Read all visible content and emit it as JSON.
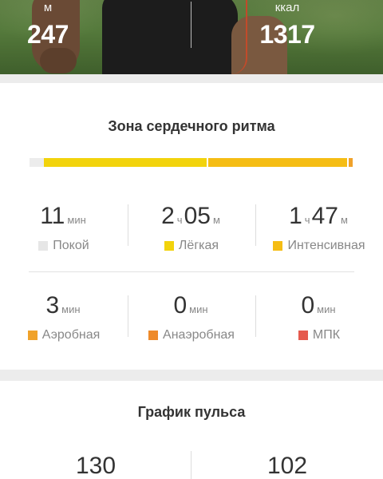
{
  "hero": {
    "left": {
      "unit": "м",
      "value": "247"
    },
    "right": {
      "unit": "ккал",
      "value": "1317"
    }
  },
  "heart_zone": {
    "title": "Зона сердечного ритма",
    "bar_fractions": {
      "rest": 0.045,
      "light": 0.51,
      "intensive": 0.44,
      "aerobic": 0.012
    },
    "zones": [
      {
        "value_parts": [
          {
            "n": "11",
            "u": "мин"
          }
        ],
        "label": "Покой",
        "color": "#e6e6e6"
      },
      {
        "value_parts": [
          {
            "n": "2",
            "u": "ч"
          },
          {
            "n": "05",
            "u": "м"
          }
        ],
        "label": "Лёгкая",
        "color": "#f2d30c"
      },
      {
        "value_parts": [
          {
            "n": "1",
            "u": "ч"
          },
          {
            "n": "47",
            "u": "м"
          }
        ],
        "label": "Интенсивная",
        "color": "#f5bd14"
      },
      {
        "value_parts": [
          {
            "n": "3",
            "u": "мин"
          }
        ],
        "label": "Аэробная",
        "color": "#f0a22a"
      },
      {
        "value_parts": [
          {
            "n": "0",
            "u": "мин"
          }
        ],
        "label": "Анаэробная",
        "color": "#ee8a2a"
      },
      {
        "value_parts": [
          {
            "n": "0",
            "u": "мин"
          }
        ],
        "label": "МПК",
        "color": "#e55a4e"
      }
    ]
  },
  "pulse": {
    "title": "График пульса",
    "left_value": "130",
    "right_value": "102"
  }
}
